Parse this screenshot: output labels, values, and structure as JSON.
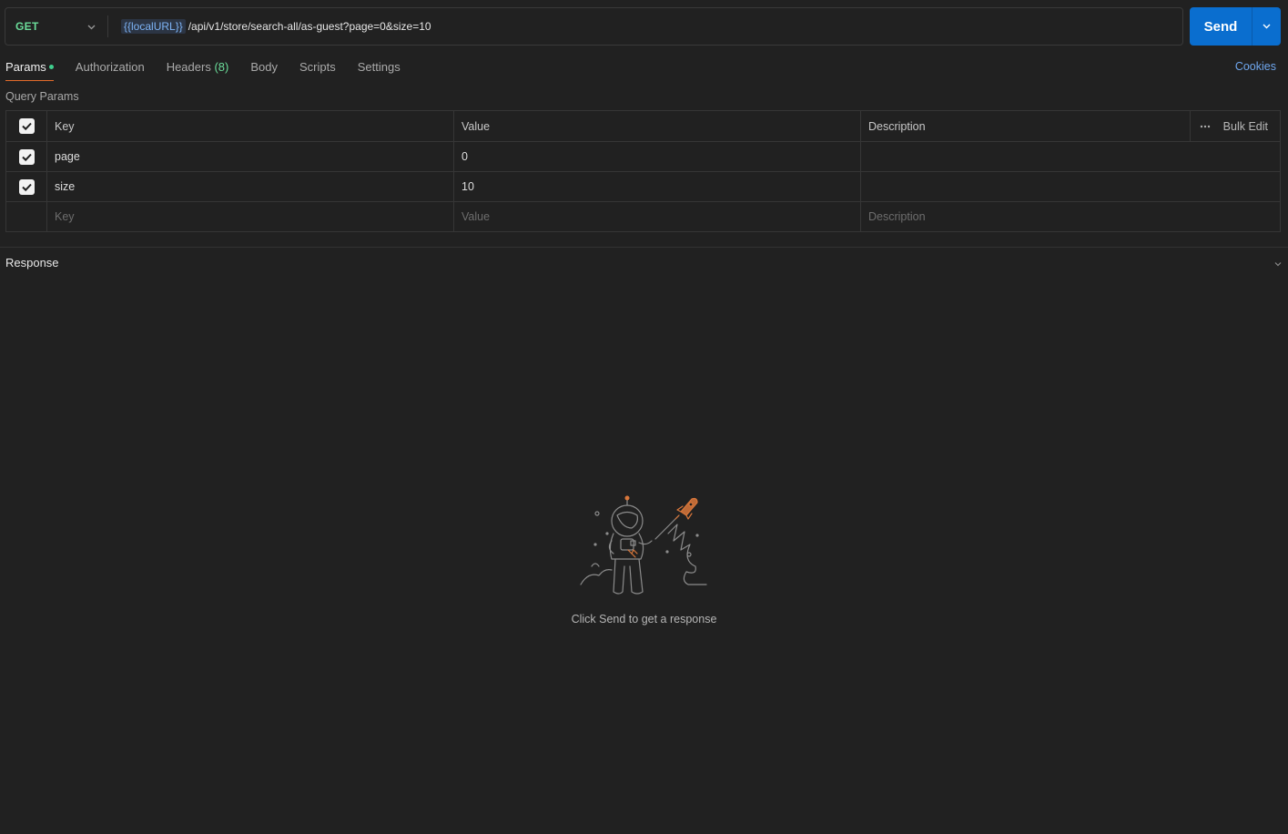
{
  "request": {
    "method": "GET",
    "url_variable": "{{localURL}}",
    "url_path": "/api/v1/store/search-all/as-guest?page=0&size=10",
    "send_label": "Send"
  },
  "tabs": [
    {
      "label": "Params",
      "active": true
    },
    {
      "label": "Authorization"
    },
    {
      "label": "Headers",
      "count": "(8)"
    },
    {
      "label": "Body"
    },
    {
      "label": "Scripts"
    },
    {
      "label": "Settings"
    }
  ],
  "cookies_label": "Cookies",
  "query_params": {
    "section_label": "Query Params",
    "headers": {
      "key": "Key",
      "value": "Value",
      "description": "Description",
      "bulk_edit": "Bulk Edit"
    },
    "rows": [
      {
        "key": "page",
        "value": "0",
        "description": "",
        "checked": true
      },
      {
        "key": "size",
        "value": "10",
        "description": "",
        "checked": true
      }
    ],
    "placeholders": {
      "key": "Key",
      "value": "Value",
      "description": "Description"
    }
  },
  "response": {
    "label": "Response",
    "empty_message": "Click Send to get a response"
  },
  "colors": {
    "method_get": "#6bdd9a",
    "send_button": "#0a6ecf",
    "active_tab_underline": "#e36b2b",
    "link": "#6fa7ee",
    "url_variable": "#7db3f5",
    "illustration_accent": "#d9773b"
  },
  "icons": [
    "chevron-down-icon",
    "more-horizontal-icon",
    "check-icon",
    "astronaut-rocket-illustration"
  ]
}
